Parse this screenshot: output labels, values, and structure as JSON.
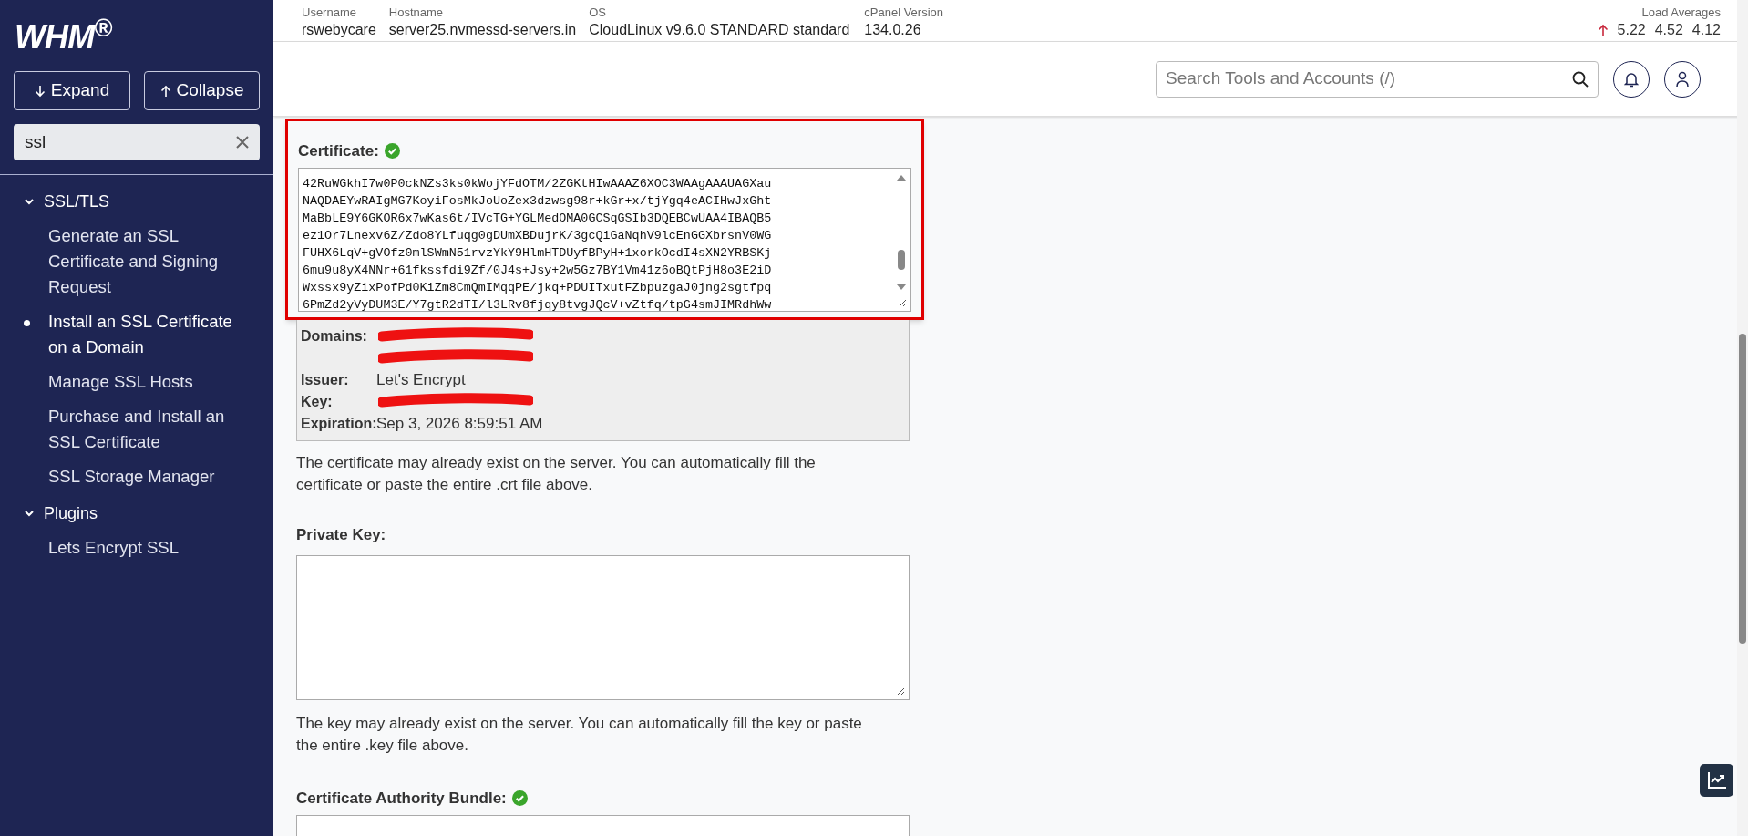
{
  "sidebar": {
    "logo": "WHM$^{®}$",
    "expand_button": "Expand",
    "collapse_button": "Collapse",
    "search": {
      "value": "ssl"
    },
    "groups": [
      {
        "label": "SSL/TLS",
        "expanded": true,
        "items": [
          {
            "label": "Generate an SSL Certificate and Signing Request",
            "selected": false
          },
          {
            "label": "Install an SSL Certificate on a Domain",
            "selected": true
          },
          {
            "label": "Manage SSL Hosts",
            "selected": false
          },
          {
            "label": "Purchase and Install an SSL Certificate",
            "selected": false
          },
          {
            "label": "SSL Storage Manager",
            "selected": false
          }
        ]
      },
      {
        "label": "Plugins",
        "expanded": true,
        "items": [
          {
            "label": "Lets Encrypt SSL",
            "selected": false
          }
        ]
      }
    ]
  },
  "server_info": [
    {
      "label": "Username",
      "value": "rswebycare"
    },
    {
      "label": "Hostname",
      "value": "server25.nvmessd-servers.in"
    },
    {
      "label": "OS",
      "value": "CloudLinux v9.6.0 STANDARD standard"
    },
    {
      "label": "cPanel Version",
      "value": "134.0.26"
    }
  ],
  "load_averages": {
    "label": "Load Averages",
    "rising": true,
    "values": [
      "5.22",
      "4.52",
      "4.12"
    ]
  },
  "search": {
    "placeholder": "Search Tools and Accounts (/)"
  },
  "certificate": {
    "label": "Certificate:",
    "valid": true,
    "highlighted": true,
    "lines": [
      "42RuWGkhI7w0P0ckNZs3ks0kWojYFdOTM/2ZGKtHIwAAAZ6XOC3WAAgAAAUAGXau",
      "NAQDAEYwRAIgMG7KoyiFosMkJoUoZex3dzwsg98r+kGr+x/tjYgq4eACIHwJxGht",
      "MaBbLE9Y6GKOR6x7wKas6t/IVcTG+YGLMedOMA0GCSqGSIb3DQEBCwUAA4IBAQB5",
      "ez1Or7Lnexv6Z/Zdo8YLfuqg0gDUmXBDujrK/3gcQiGaNqhV9lcEnGGXbrsnV0WG",
      "FUHX6LqV+gVOfz0mlSWmN51rvzYkY9HlmHTDUyfBPyH+1xorkOcdI4sXN2YRBSKj",
      "6mu9u8yX4NNr+61fkssfdi9Zf/0J4s+Jsy+2w5Gz7BY1Vm41z6oBQtPjH8o3E2iD",
      "Wxssx9yZixPofPd0KiZm8CmQmIMqqPE/jkq+PDUITxutFZbpuzgaJ0jng2sgtfpq",
      "6PmZd2yVyDUM3E/Y7gtR2dTI/l3LRv8fjqy8tvgJQcV+vZtfq/tpG4smJIMRdhWw"
    ],
    "details": [
      {
        "label": "Domains:",
        "values": [
          {
            "redacted": true
          },
          {
            "redacted": true
          }
        ]
      },
      {
        "label": "Issuer:",
        "values": [
          {
            "text": "Let's Encrypt",
            "redacted": false
          }
        ]
      },
      {
        "label": "Key:",
        "values": [
          {
            "redacted": true
          }
        ]
      },
      {
        "label": "Expiration:",
        "values": [
          {
            "text": "Sep 3, 2026 8:59:51 AM",
            "redacted": false
          }
        ]
      }
    ],
    "help": "The certificate may already exist on the server. You can automatically fill the certificate or paste the entire .crt file above."
  },
  "private_key": {
    "label": "Private Key:",
    "valid": false,
    "help": "The key may already exist on the server. You can automatically fill the key or paste the entire .key file above."
  },
  "ca_bundle": {
    "label": "Certificate Authority Bundle:",
    "valid": true
  }
}
